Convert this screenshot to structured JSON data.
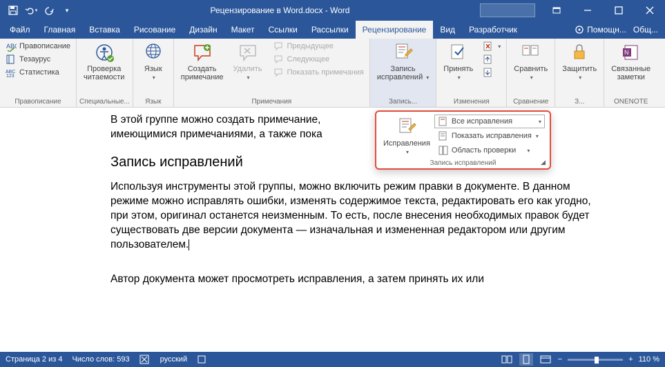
{
  "titlebar": {
    "title": "Рецензирование в Word.docx - Word"
  },
  "tabs": {
    "items": [
      "Файл",
      "Главная",
      "Вставка",
      "Рисование",
      "Дизайн",
      "Макет",
      "Ссылки",
      "Рассылки",
      "Рецензирование",
      "Вид",
      "Разработчик"
    ],
    "active_index": 8,
    "help": "Помощн...",
    "share": "Общ..."
  },
  "ribbon": {
    "proofing": {
      "spelling": "Правописание",
      "thesaurus": "Тезаурус",
      "stats": "Статистика",
      "group": "Правописание"
    },
    "readability": {
      "btn": "Проверка\nчитаемости",
      "group": "Специальные..."
    },
    "language": {
      "btn": "Язык",
      "group": "Язык"
    },
    "comments": {
      "new": "Создать\nпримечание",
      "delete": "Удалить",
      "prev": "Предыдущее",
      "next": "Следующее",
      "show": "Показать примечания",
      "group": "Примечания"
    },
    "tracking": {
      "btn": "Запись\nисправлений",
      "group": "Запись..."
    },
    "changes": {
      "accept": "Принять",
      "group": "Изменения"
    },
    "compare": {
      "btn": "Сравнить",
      "group": "Сравнение"
    },
    "protect": {
      "btn": "Защитить",
      "group": "З..."
    },
    "onenote": {
      "btn": "Связанные\nзаметки",
      "group": "ONENOTE"
    }
  },
  "callout": {
    "track_btn": "Исправления",
    "display_mode": "Все исправления",
    "show_markup": "Показать исправления",
    "reviewing_pane": "Область проверки",
    "footer": "Запись исправлений"
  },
  "document": {
    "p1": "В этой группе можно создать примечание,",
    "p1b": "имеющимися примечаниями, а также пока",
    "h2": "Запись исправлений",
    "p2": "Используя инструменты этой группы, можно включить режим правки в документе. В данном режиме можно исправлять ошибки, изменять содержимое текста, редактировать его как угодно, при этом, оригинал останется неизменным. То есть, после внесения необходимых правок будет существовать две версии документа — изначальная и измененная редактором или другим пользователем.",
    "p3": "Автор документа может просмотреть исправления, а затем принять их или"
  },
  "statusbar": {
    "page": "Страница 2 из 4",
    "words": "Число слов: 593",
    "lang": "русский",
    "zoom": "110 %"
  }
}
